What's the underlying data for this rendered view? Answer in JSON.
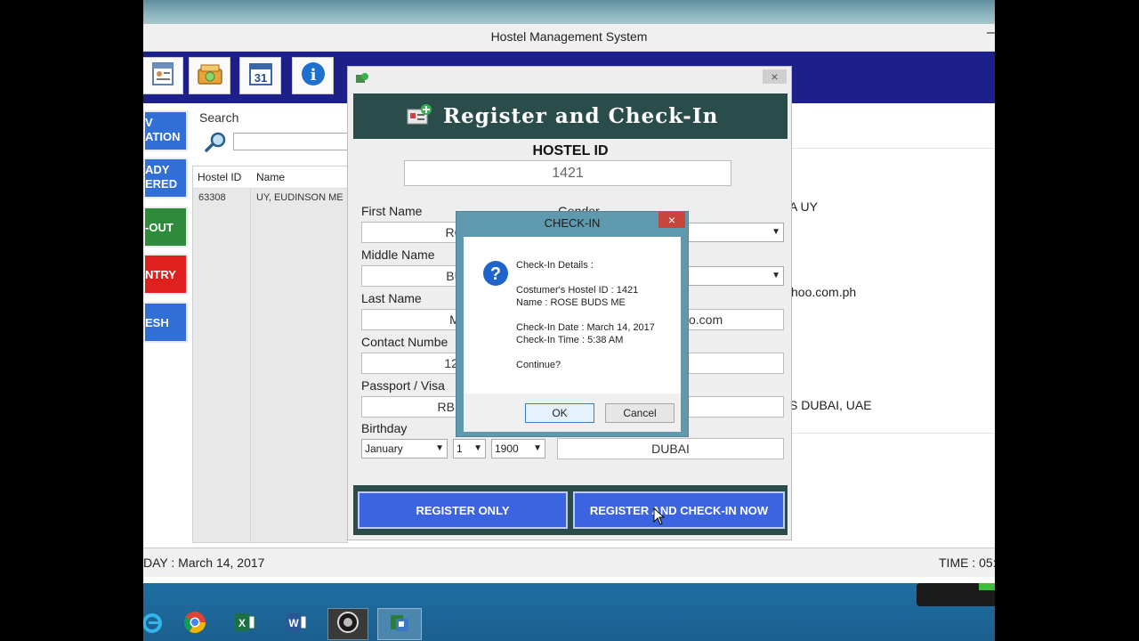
{
  "window": {
    "title": "Hostel Management System",
    "minimize_glyph": "–"
  },
  "toolbar": {
    "icons": [
      "guest-list-icon",
      "cash-register-icon",
      "calendar-icon",
      "info-icon"
    ],
    "calendar_day": "31",
    "info_glyph": "i"
  },
  "sidebar": {
    "items": [
      {
        "label": "V\nATION",
        "color": "#2f6fd6"
      },
      {
        "label": "ADY\nERED",
        "color": "#2f6fd6"
      },
      {
        "label": "-OUT",
        "color": "#2e8b3b"
      },
      {
        "label": "NTRY",
        "color": "#e01f1f"
      },
      {
        "label": "ESH",
        "color": "#2f6fd6"
      }
    ]
  },
  "search": {
    "label": "Search",
    "placeholder": ""
  },
  "table": {
    "headers": [
      "Hostel ID",
      "Name"
    ],
    "rows": [
      {
        "id": "63308",
        "name": "UY, EUDINSON ME"
      }
    ]
  },
  "details_peek": {
    "name": "A UY",
    "email": "hoo.com.ph",
    "address": "S DUBAI, UAE"
  },
  "statusbar": {
    "day": "DAY : March 14, 2017",
    "time": "TIME : 05:"
  },
  "taskbar": {
    "apps": [
      "ie-icon",
      "chrome-icon",
      "excel-icon",
      "word-icon",
      "camera-app-icon",
      "hostel-app-icon"
    ]
  },
  "register": {
    "title": "Register and Check-In",
    "close_glyph": "×",
    "hostel_id_label": "HOSTEL ID",
    "hostel_id_value": "1421",
    "first_name_label": "First Name",
    "first_name_value": "RO",
    "gender_label": "Gender",
    "middle_name_label": "Middle Name",
    "middle_name_value": "BU",
    "last_name_label": "Last Name",
    "last_name_value": "M",
    "email_value_peek": "o.com",
    "contact_label": "Contact Numbe",
    "contact_value": "123",
    "passport_label": "Passport / Visa",
    "passport_value": "RBM0",
    "birthday_label": "Birthday",
    "birth_month": "January",
    "birth_day": "1",
    "birth_year": "1900",
    "city_value": "DUBAI",
    "register_only_label": "REGISTER ONLY",
    "register_checkin_label": "REGISTER AND CHECK-IN NOW"
  },
  "checkin_dialog": {
    "title": "CHECK-IN",
    "close_glyph": "×",
    "icon_glyph": "?",
    "line_details": "Check-In Details :",
    "line_id": "Costumer's Hostel ID : 1421",
    "line_name": "Name : ROSE BUDS ME",
    "line_date": "Check-In Date : March 14, 2017",
    "line_time": "Check-In Time : 5:38 AM",
    "line_continue": "Continue?",
    "ok_label": "OK",
    "cancel_label": "Cancel"
  },
  "colors": {
    "toolbar": "#1d1f8a",
    "dialog_header": "#2a4d4b",
    "action_button": "#3c64e0",
    "checkin_frame": "#5f99ad",
    "taskbar": "#1f6fa3"
  }
}
